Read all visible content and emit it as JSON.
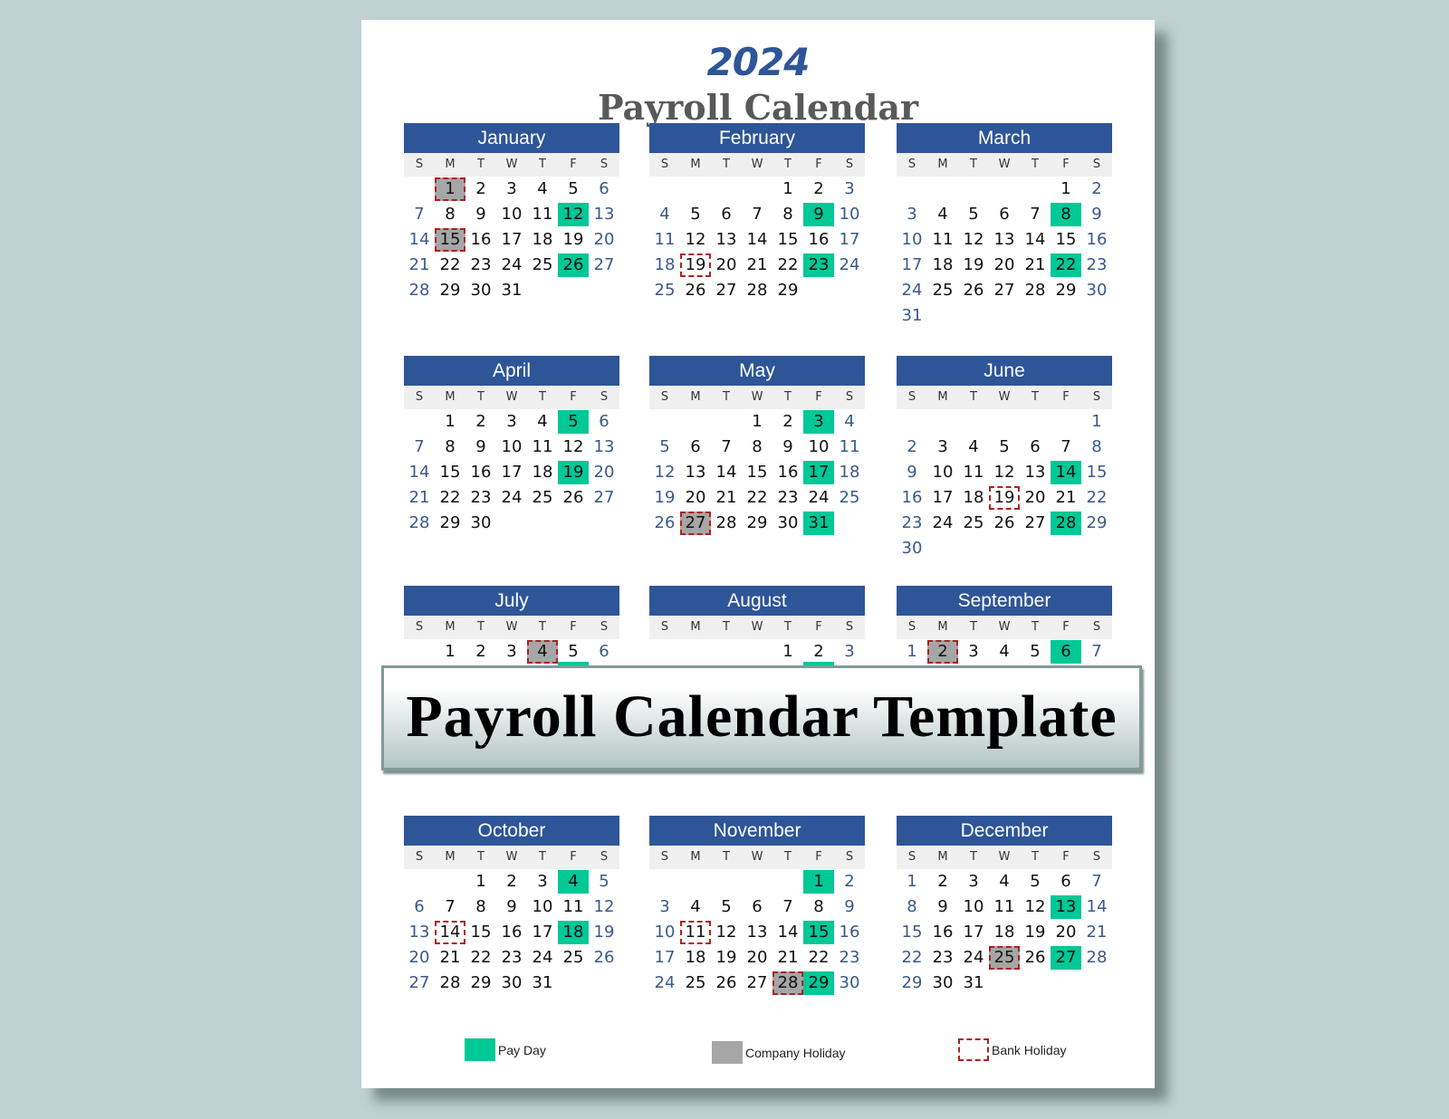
{
  "header": {
    "year": "2024",
    "title": "Payroll Calendar"
  },
  "weekdays": [
    "S",
    "M",
    "T",
    "W",
    "T",
    "F",
    "S"
  ],
  "colors": {
    "header": "#2e5597",
    "pay_day": "#00c896",
    "company_holiday": "#a6a6a6",
    "bank_holiday": "#b02020",
    "weekend_text": "#3a5a8a"
  },
  "months": [
    {
      "name": "January",
      "first_weekday": 1,
      "days": 31,
      "pay": [
        12,
        26
      ],
      "company": [
        1,
        15
      ],
      "bank": [
        1,
        15
      ]
    },
    {
      "name": "February",
      "first_weekday": 4,
      "days": 29,
      "pay": [
        9,
        23
      ],
      "company": [],
      "bank": [
        19
      ]
    },
    {
      "name": "March",
      "first_weekday": 5,
      "days": 31,
      "pay": [
        8,
        22
      ],
      "company": [],
      "bank": []
    },
    {
      "name": "April",
      "first_weekday": 1,
      "days": 30,
      "pay": [
        5,
        19
      ],
      "company": [],
      "bank": []
    },
    {
      "name": "May",
      "first_weekday": 3,
      "days": 31,
      "pay": [
        3,
        17,
        31
      ],
      "company": [
        27
      ],
      "bank": [
        27
      ]
    },
    {
      "name": "June",
      "first_weekday": 6,
      "days": 30,
      "pay": [
        14,
        28
      ],
      "company": [],
      "bank": [
        19
      ]
    },
    {
      "name": "July",
      "first_weekday": 1,
      "days": 6,
      "pay": [],
      "company": [
        4
      ],
      "bank": [
        4
      ]
    },
    {
      "name": "August",
      "first_weekday": 4,
      "days": 3,
      "pay": [],
      "company": [],
      "bank": []
    },
    {
      "name": "September",
      "first_weekday": 0,
      "days": 7,
      "pay": [
        6
      ],
      "company": [
        2
      ],
      "bank": [
        2
      ]
    },
    {
      "name": "October",
      "first_weekday": 2,
      "days": 31,
      "pay": [
        4,
        18
      ],
      "company": [],
      "bank": [
        14
      ]
    },
    {
      "name": "November",
      "first_weekday": 5,
      "days": 30,
      "pay": [
        1,
        15,
        29
      ],
      "company": [
        28
      ],
      "bank": [
        11,
        28
      ]
    },
    {
      "name": "December",
      "first_weekday": 0,
      "days": 31,
      "pay": [
        13,
        27
      ],
      "company": [
        25
      ],
      "bank": [
        25
      ]
    }
  ],
  "banner": {
    "text": "Payroll Calendar Template"
  },
  "legend": {
    "pay_day": "Pay Day",
    "company_holiday": "Company Holiday",
    "bank_holiday": "Bank Holiday"
  }
}
